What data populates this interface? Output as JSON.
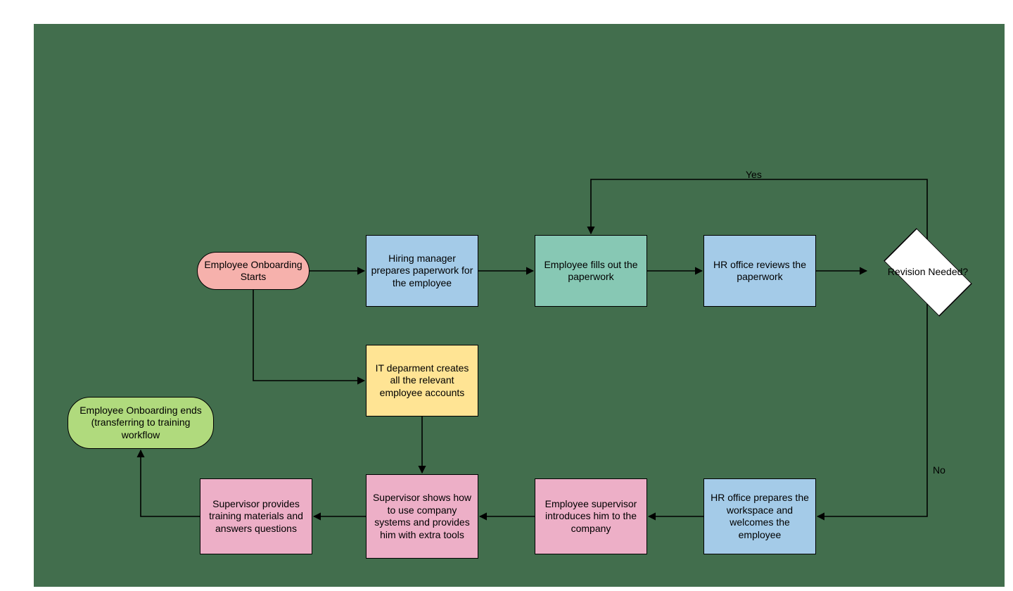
{
  "colors": {
    "start": "#f6b1ac",
    "end": "#b0da7d",
    "blue": "#a4cbe8",
    "teal": "#87c8b4",
    "yellow": "#ffe494",
    "pink": "#edafc7",
    "decision": "#ffffff",
    "bg": "#426e4d"
  },
  "nodes": {
    "start": {
      "label": "Employee Onboarding Starts"
    },
    "hiring": {
      "label": "Hiring manager prepares paperwork for the employee"
    },
    "fills": {
      "label": "Employee fills out the paperwork"
    },
    "hr_review": {
      "label": "HR office reviews the paperwork"
    },
    "decision": {
      "label": "Revision Needed?"
    },
    "it": {
      "label": "IT deparment creates all the relevant employee accounts"
    },
    "hr_prep": {
      "label": "HR office prepares the workspace and welcomes the employee"
    },
    "sup_intro": {
      "label": "Employee supervisor introduces him to the company"
    },
    "sup_show": {
      "label": "Supervisor shows how to use company systems and provides him with extra tools"
    },
    "sup_train": {
      "label": "Supervisor provides training materials and answers questions"
    },
    "end": {
      "label": "Employee Onboarding ends (transferring to training workflow"
    }
  },
  "edge_labels": {
    "yes": "Yes",
    "no": "No"
  },
  "chart_data": {
    "type": "flowchart",
    "title": "Employee Onboarding Workflow",
    "nodes": [
      {
        "id": "start",
        "shape": "terminator",
        "color": "start",
        "label": "Employee Onboarding Starts"
      },
      {
        "id": "hiring",
        "shape": "process",
        "color": "blue",
        "label": "Hiring manager prepares paperwork for the employee"
      },
      {
        "id": "fills",
        "shape": "process",
        "color": "teal",
        "label": "Employee fills out the paperwork"
      },
      {
        "id": "hr_review",
        "shape": "process",
        "color": "blue",
        "label": "HR office reviews the paperwork"
      },
      {
        "id": "decision",
        "shape": "decision",
        "color": "decision",
        "label": "Revision Needed?"
      },
      {
        "id": "it",
        "shape": "process",
        "color": "yellow",
        "label": "IT deparment creates all the relevant employee accounts"
      },
      {
        "id": "hr_prep",
        "shape": "process",
        "color": "blue",
        "label": "HR office prepares the workspace and welcomes the employee"
      },
      {
        "id": "sup_intro",
        "shape": "process",
        "color": "pink",
        "label": "Employee supervisor introduces him to the company"
      },
      {
        "id": "sup_show",
        "shape": "process",
        "color": "pink",
        "label": "Supervisor shows how to use company systems and provides him with extra tools"
      },
      {
        "id": "sup_train",
        "shape": "process",
        "color": "pink",
        "label": "Supervisor provides training materials and answers questions"
      },
      {
        "id": "end",
        "shape": "terminator",
        "color": "end",
        "label": "Employee Onboarding ends (transferring to training workflow"
      }
    ],
    "edges": [
      {
        "from": "start",
        "to": "hiring"
      },
      {
        "from": "hiring",
        "to": "fills"
      },
      {
        "from": "fills",
        "to": "hr_review"
      },
      {
        "from": "hr_review",
        "to": "decision"
      },
      {
        "from": "decision",
        "to": "fills",
        "label": "Yes"
      },
      {
        "from": "decision",
        "to": "hr_prep",
        "label": "No"
      },
      {
        "from": "start",
        "to": "it"
      },
      {
        "from": "it",
        "to": "sup_show"
      },
      {
        "from": "hr_prep",
        "to": "sup_intro"
      },
      {
        "from": "sup_intro",
        "to": "sup_show"
      },
      {
        "from": "sup_show",
        "to": "sup_train"
      },
      {
        "from": "sup_train",
        "to": "end"
      }
    ]
  }
}
